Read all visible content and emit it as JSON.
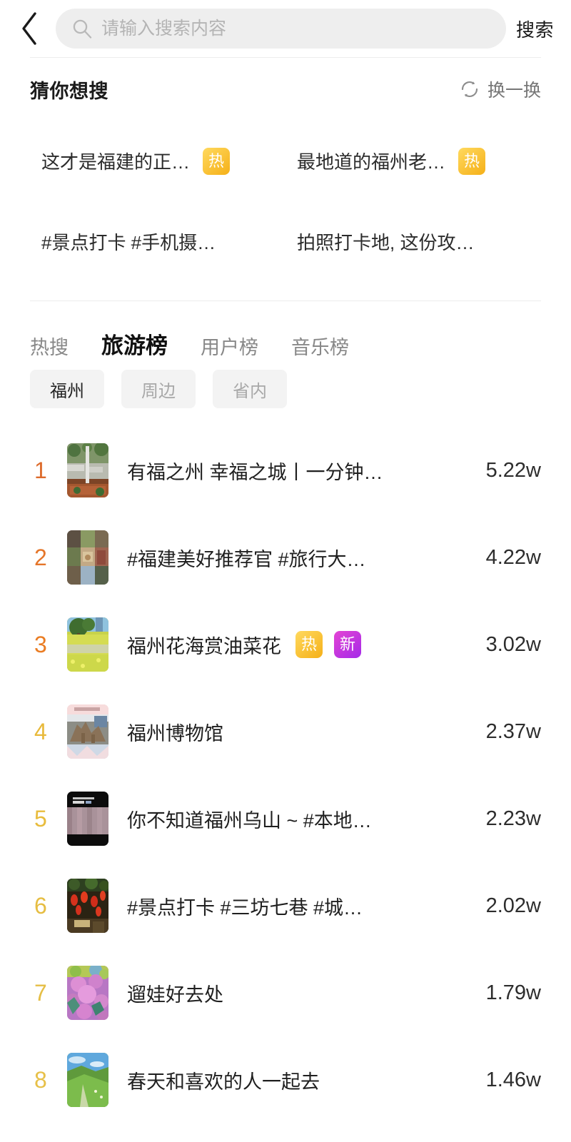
{
  "header": {
    "back_icon": "chevron-left-icon",
    "search_icon": "search-icon",
    "search_value": "",
    "search_placeholder": "请输入搜索内容",
    "search_action_label": "搜索"
  },
  "guess": {
    "title": "猜你想搜",
    "refresh_icon": "refresh-icon",
    "refresh_label": "换一换",
    "items": [
      {
        "text": "这才是福建的正…",
        "badge": "热"
      },
      {
        "text": "最地道的福州老…",
        "badge": "热"
      },
      {
        "text": "#景点打卡 #手机摄…",
        "badge": ""
      },
      {
        "text": "拍照打卡地, 这份攻…",
        "badge": ""
      }
    ]
  },
  "tabs": [
    {
      "label": "热搜",
      "active": false
    },
    {
      "label": "旅游榜",
      "active": true
    },
    {
      "label": "用户榜",
      "active": false
    },
    {
      "label": "音乐榜",
      "active": false
    }
  ],
  "chips": [
    {
      "label": "福州",
      "active": true
    },
    {
      "label": "周边",
      "active": false
    },
    {
      "label": "省内",
      "active": false
    }
  ],
  "colors": {
    "rank_1": "#dd6b2c",
    "rank_2": "#e5762a",
    "rank_3": "#ea7c22",
    "rank_4": "#e8b93a",
    "rank_5": "#e8bc3c",
    "rank_6": "#e6bd42",
    "rank_7": "#e5be45",
    "rank_8": "#e7c048",
    "badge_hot": "#f5b018",
    "badge_new": "#b32ae0",
    "search_pill": "#eeeeee",
    "chip_bg": "#f3f3f3"
  },
  "rank_list": [
    {
      "rank": "1",
      "title": "有福之州 幸福之城丨一分钟…",
      "count": "5.22w",
      "badges": [],
      "thumb": "aerial-village-roofs"
    },
    {
      "rank": "2",
      "title": "#福建美好推荐官 #旅行大…",
      "count": "4.22w",
      "badges": [],
      "thumb": "photo-collage-temple"
    },
    {
      "rank": "3",
      "title": "福州花海赏油菜花",
      "count": "3.02w",
      "badges": [
        "热",
        "新"
      ],
      "thumb": "rapeseed-flower-field"
    },
    {
      "rank": "4",
      "title": "福州博物馆",
      "count": "2.37w",
      "badges": [],
      "thumb": "museum-dinosaur-skeleton"
    },
    {
      "rank": "5",
      "title": "你不知道福州乌山 ~ #本地…",
      "count": "2.23w",
      "badges": [],
      "thumb": "dark-wood-plank-video"
    },
    {
      "rank": "6",
      "title": "#景点打卡 #三坊七巷  #城…",
      "count": "2.02w",
      "badges": [],
      "thumb": "red-lanterns-street"
    },
    {
      "rank": "7",
      "title": "遛娃好去处",
      "count": "1.79w",
      "badges": [],
      "thumb": "purple-azalea-flowers"
    },
    {
      "rank": "8",
      "title": "春天和喜欢的人一起去",
      "count": "1.46w",
      "badges": [],
      "thumb": "green-hill-blue-sky"
    }
  ]
}
